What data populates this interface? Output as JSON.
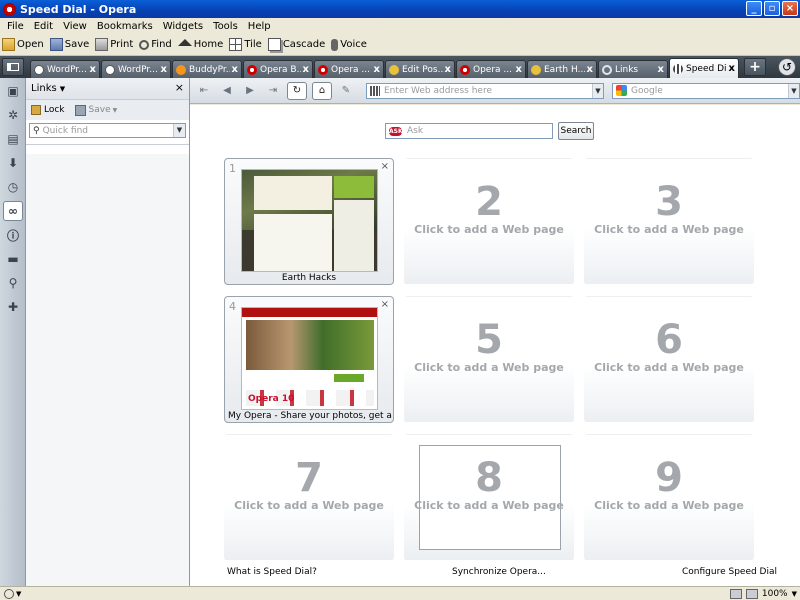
{
  "window": {
    "title": "Speed Dial - Opera",
    "minimize": "_",
    "maximize": "▫",
    "close": "×"
  },
  "menu": [
    "File",
    "Edit",
    "View",
    "Bookmarks",
    "Widgets",
    "Tools",
    "Help"
  ],
  "toolbar": {
    "open": "Open",
    "save": "Save",
    "print": "Print",
    "find": "Find",
    "home": "Home",
    "tile": "Tile",
    "cascade": "Cascade",
    "voice": "Voice"
  },
  "tabs": [
    {
      "label": "WordPr...",
      "icon": "wordpress-icon"
    },
    {
      "label": "WordPr...",
      "icon": "wordpress-icon"
    },
    {
      "label": "BuddyPr...",
      "icon": "buddypress-icon"
    },
    {
      "label": "Opera B...",
      "icon": "opera-icon"
    },
    {
      "label": "Opera ...",
      "icon": "opera-icon"
    },
    {
      "label": "Edit Pos...",
      "icon": "pen-icon"
    },
    {
      "label": "Opera ...",
      "icon": "opera-icon"
    },
    {
      "label": "Earth H...",
      "icon": "pen-icon"
    },
    {
      "label": "Links",
      "icon": "links-icon"
    },
    {
      "label": "Speed Dial",
      "icon": "speed-dial-icon",
      "active": true
    }
  ],
  "tab_close": "x",
  "new_tab": "+",
  "reopen": "↺",
  "panel": {
    "title": "Links",
    "title_arrow": "▼",
    "close": "×",
    "lock": "Lock",
    "save": "Save",
    "save_arrow": "▼",
    "quickfind_placeholder": "Quick find",
    "dropdown": "▼"
  },
  "sidebar_icons": [
    "bookmarks-icon",
    "widgets-icon",
    "notes-icon",
    "downloads-icon",
    "history-icon",
    "links-icon",
    "info-icon",
    "windows-icon",
    "search-icon",
    "add-panel-icon"
  ],
  "sidebar_glyphs": [
    "▣",
    "✲",
    "▤",
    "⬇",
    "◷",
    "∞",
    "ⓘ",
    "▬",
    "⚲",
    "✚"
  ],
  "nav": {
    "rewind": "⇤",
    "back": "◀",
    "forward": "▶",
    "fastforward": "⇥",
    "reload": "↻",
    "home": "⌂",
    "wand": "✎"
  },
  "address": {
    "placeholder": "Enter Web address here",
    "dropdown": "▼"
  },
  "search_engine": {
    "placeholder": "Google",
    "dropdown": "▼"
  },
  "ask": {
    "logo": "ASK",
    "placeholder": "Ask",
    "button": "Search"
  },
  "dials": [
    {
      "number": "1",
      "title": "Earth Hacks",
      "filled": true,
      "close": "×"
    },
    {
      "number": "2",
      "hint": "Click to add a Web page"
    },
    {
      "number": "3",
      "hint": "Click to add a Web page"
    },
    {
      "number": "4",
      "title": "My Opera - Share your photos, get a f...",
      "filled": true,
      "close": "×",
      "thumb_logo": "Opera 10"
    },
    {
      "number": "5",
      "hint": "Click to add a Web page"
    },
    {
      "number": "6",
      "hint": "Click to add a Web page"
    },
    {
      "number": "7",
      "hint": "Click to add a Web page"
    },
    {
      "number": "8",
      "hint": "Click to add a Web page",
      "selected": true
    },
    {
      "number": "9",
      "hint": "Click to add a Web page"
    }
  ],
  "footer": {
    "what_is": "What is Speed Dial?",
    "sync": "Synchronize Opera...",
    "configure": "Configure Speed Dial"
  },
  "status": {
    "zoom": "100%",
    "zoom_arrow": "▼"
  }
}
